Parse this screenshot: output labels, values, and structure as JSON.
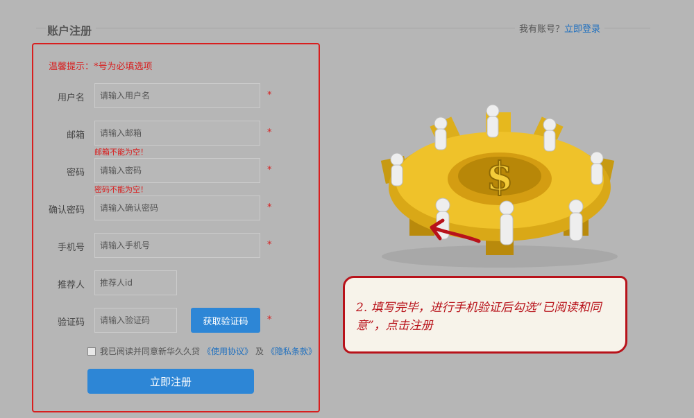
{
  "header": {
    "title": "账户注册",
    "login_prompt": "我有账号？",
    "login_link": "立即登录"
  },
  "form": {
    "tip": "温馨提示：*号为必填选项",
    "required_mark": "*",
    "fields": {
      "username": {
        "label": "用户名",
        "placeholder": "请输入用户名"
      },
      "email": {
        "label": "邮箱",
        "placeholder": "请输入邮箱",
        "error": "邮箱不能为空！"
      },
      "password": {
        "label": "密码",
        "placeholder": "请输入密码",
        "error": "密码不能为空！"
      },
      "confirm_password": {
        "label": "确认密码",
        "placeholder": "请输入确认密码"
      },
      "phone": {
        "label": "手机号",
        "placeholder": "请输入手机号"
      },
      "referrer": {
        "label": "推荐人",
        "placeholder": "推荐人id"
      },
      "captcha": {
        "label": "验证码",
        "placeholder": "请输入验证码"
      }
    },
    "get_code_button": "获取验证码",
    "agreement": {
      "text": "我已阅读并同意新华久久贷",
      "terms_link": "《使用协议》",
      "and": "及",
      "privacy_link": "《隐私条款》"
    },
    "submit_button": "立即注册"
  },
  "annotation": {
    "text": "2. 填写完毕，进行手机验证后勾选“已阅读和同意”，点击注册"
  },
  "colors": {
    "accent": "#2d86d6",
    "error": "#d81e1e",
    "link": "#1e6fbf",
    "background": "#b6b6b6"
  },
  "icons": [
    "gear-dollar-illustration",
    "arrow-annotation-icon",
    "checkbox-icon"
  ]
}
